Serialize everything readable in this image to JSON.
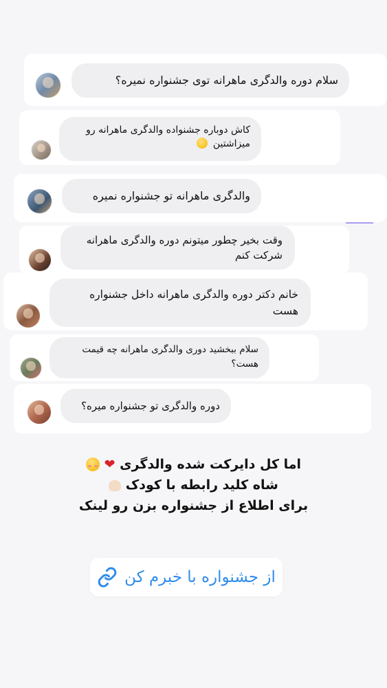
{
  "comments": [
    {
      "text": "سلام دوره والدگری ماهرانه توی جشنواره نمیره؟"
    },
    {
      "text": "کاش دوباره جشنواده والدگری ماهرانه رو میزاشتین"
    },
    {
      "text": "والدگری ماهرانه تو جشنواره نمیره"
    },
    {
      "text": "وقت بخیر  چطور میتونم دوره والدگری ماهرانه شرکت کنم"
    },
    {
      "text": "خانم دکتر دوره والدگری ماهرانه داخل جشنواره هست"
    },
    {
      "text": "سلام ببخشید دوری والدگری ماهرانه چه قیمت هست؟"
    },
    {
      "text": "دوره والدگری تو جشنواره میره؟"
    }
  ],
  "caption": {
    "line1": "اما کل دایرکت شده والدگری",
    "line2": "شاه کلید رابطه با کودک",
    "line3": "برای اطلاع از جشنواره بزن رو لینک"
  },
  "link_sticker": {
    "label": "از جشنواره با خبرم کن",
    "icon": "link-icon",
    "color": "#2f8dea"
  },
  "icons": {
    "heart": "❤"
  }
}
